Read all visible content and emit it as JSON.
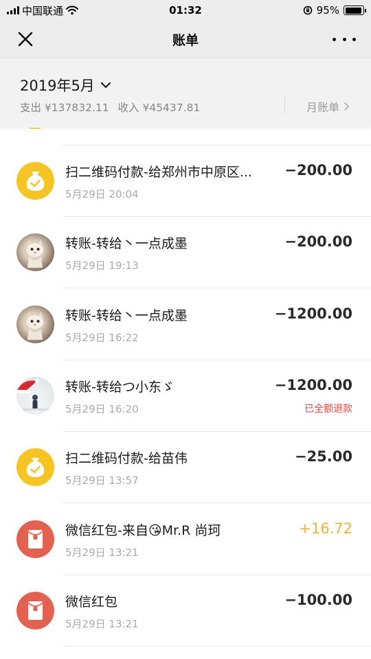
{
  "status_bar": {
    "carrier": "中国联通",
    "time": "01:32",
    "battery": "95%",
    "battery_level": 0.95
  },
  "nav": {
    "title": "账单"
  },
  "summary": {
    "month": "2019年5月",
    "expense": "支出 ¥137832.11",
    "income": "收入 ¥45437.81",
    "monthly_bill_label": "月账单"
  },
  "transactions": [
    {
      "title": "扫二维码付款-给郑州市中原区...",
      "time": "5月29日 20:04",
      "amount": "−200.00",
      "avatar": "money-bag-icon",
      "note": ""
    },
    {
      "title": "转账-转给丶一点成墨",
      "time": "5月29日 19:13",
      "amount": "−200.00",
      "avatar": "cat-avatar",
      "note": ""
    },
    {
      "title": "转账-转给丶一点成墨",
      "time": "5月29日 16:22",
      "amount": "−1200.00",
      "avatar": "cat-avatar",
      "note": ""
    },
    {
      "title": "转账-转给つ小东ゞ",
      "time": "5月29日 16:20",
      "amount": "−1200.00",
      "avatar": "santa-hat-avatar",
      "note": "已全额退款"
    },
    {
      "title": "扫二维码付款-给苗伟",
      "time": "5月29日 13:57",
      "amount": "−25.00",
      "avatar": "money-bag-icon",
      "note": ""
    },
    {
      "title": "微信红包-来自😘Mr.R 尚珂",
      "time": "5月29日 13:21",
      "amount": "+16.72",
      "avatar": "red-packet-icon",
      "note": ""
    },
    {
      "title": "微信红包",
      "time": "5月29日 13:21",
      "amount": "−100.00",
      "avatar": "red-packet-icon",
      "note": ""
    }
  ],
  "colors": {
    "header_bg": "#ededed",
    "summary_bg": "#f2f2f2",
    "income": "#f2b134",
    "refund": "#e64340",
    "money_bag": "#f6c523",
    "red_packet": "#e36150"
  }
}
